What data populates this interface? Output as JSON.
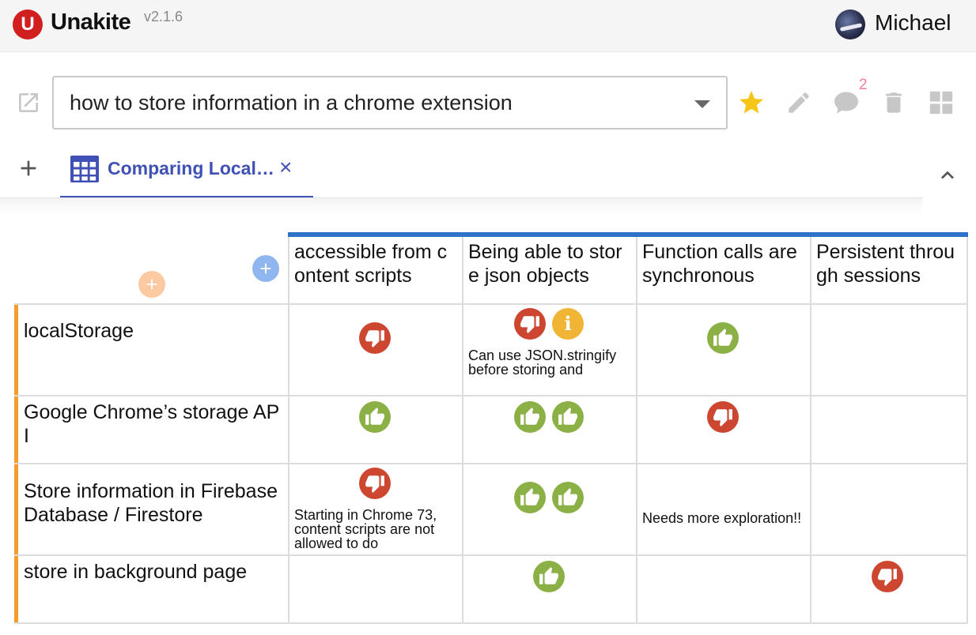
{
  "header": {
    "logo_letter": "U",
    "app_name": "Unakite",
    "version": "v2.1.6",
    "user_name": "Michael"
  },
  "query": {
    "text": "how to store information in a chrome extension",
    "comment_count": "2"
  },
  "icons": {
    "open": "open-in-new-icon",
    "star": "star-icon",
    "edit": "pencil-icon",
    "comment": "comment-icon",
    "delete": "trash-icon",
    "layout": "grid-layout-icon",
    "add_tab": "plus-icon",
    "collapse": "chevron-up-icon"
  },
  "tabs": [
    {
      "label": "Comparing Local…",
      "close": "×"
    }
  ],
  "colors": {
    "brand_red": "#d11f1f",
    "tab_accent": "#3f51b5",
    "header_stripe": "#2e73c7",
    "option_bar": "#f59c2a",
    "thumbs_up": "#8bb146",
    "thumbs_down": "#cc4630",
    "info": "#f0b535",
    "comment_badge": "#f07aa4"
  },
  "table": {
    "criteria": [
      "accessible from content scripts",
      "Being able to store json objects",
      "Function calls are synchronous",
      "Persistent through sessions"
    ],
    "options": [
      "localStorage",
      "Google Chrome’s storage API",
      "Store information in Firebase Database / Firestore",
      "store in background page"
    ],
    "cells": [
      [
        {
          "ratings": [
            "down"
          ],
          "note": ""
        },
        {
          "ratings": [
            "down",
            "info"
          ],
          "note": "Can use JSON.stringify before storing and"
        },
        {
          "ratings": [
            "up"
          ],
          "note": ""
        },
        {
          "ratings": [],
          "note": ""
        }
      ],
      [
        {
          "ratings": [
            "up"
          ],
          "note": ""
        },
        {
          "ratings": [
            "up",
            "up"
          ],
          "note": ""
        },
        {
          "ratings": [
            "down"
          ],
          "note": ""
        },
        {
          "ratings": [],
          "note": ""
        }
      ],
      [
        {
          "ratings": [
            "down"
          ],
          "note": "Starting in Chrome 73, content scripts are not allowed to do"
        },
        {
          "ratings": [
            "up",
            "up"
          ],
          "note": ""
        },
        {
          "ratings": [],
          "note": "Needs more exploration!!"
        },
        {
          "ratings": [],
          "note": ""
        }
      ],
      [
        {
          "ratings": [],
          "note": ""
        },
        {
          "ratings": [
            "up"
          ],
          "note": ""
        },
        {
          "ratings": [],
          "note": ""
        },
        {
          "ratings": [
            "down"
          ],
          "note": ""
        }
      ]
    ]
  }
}
